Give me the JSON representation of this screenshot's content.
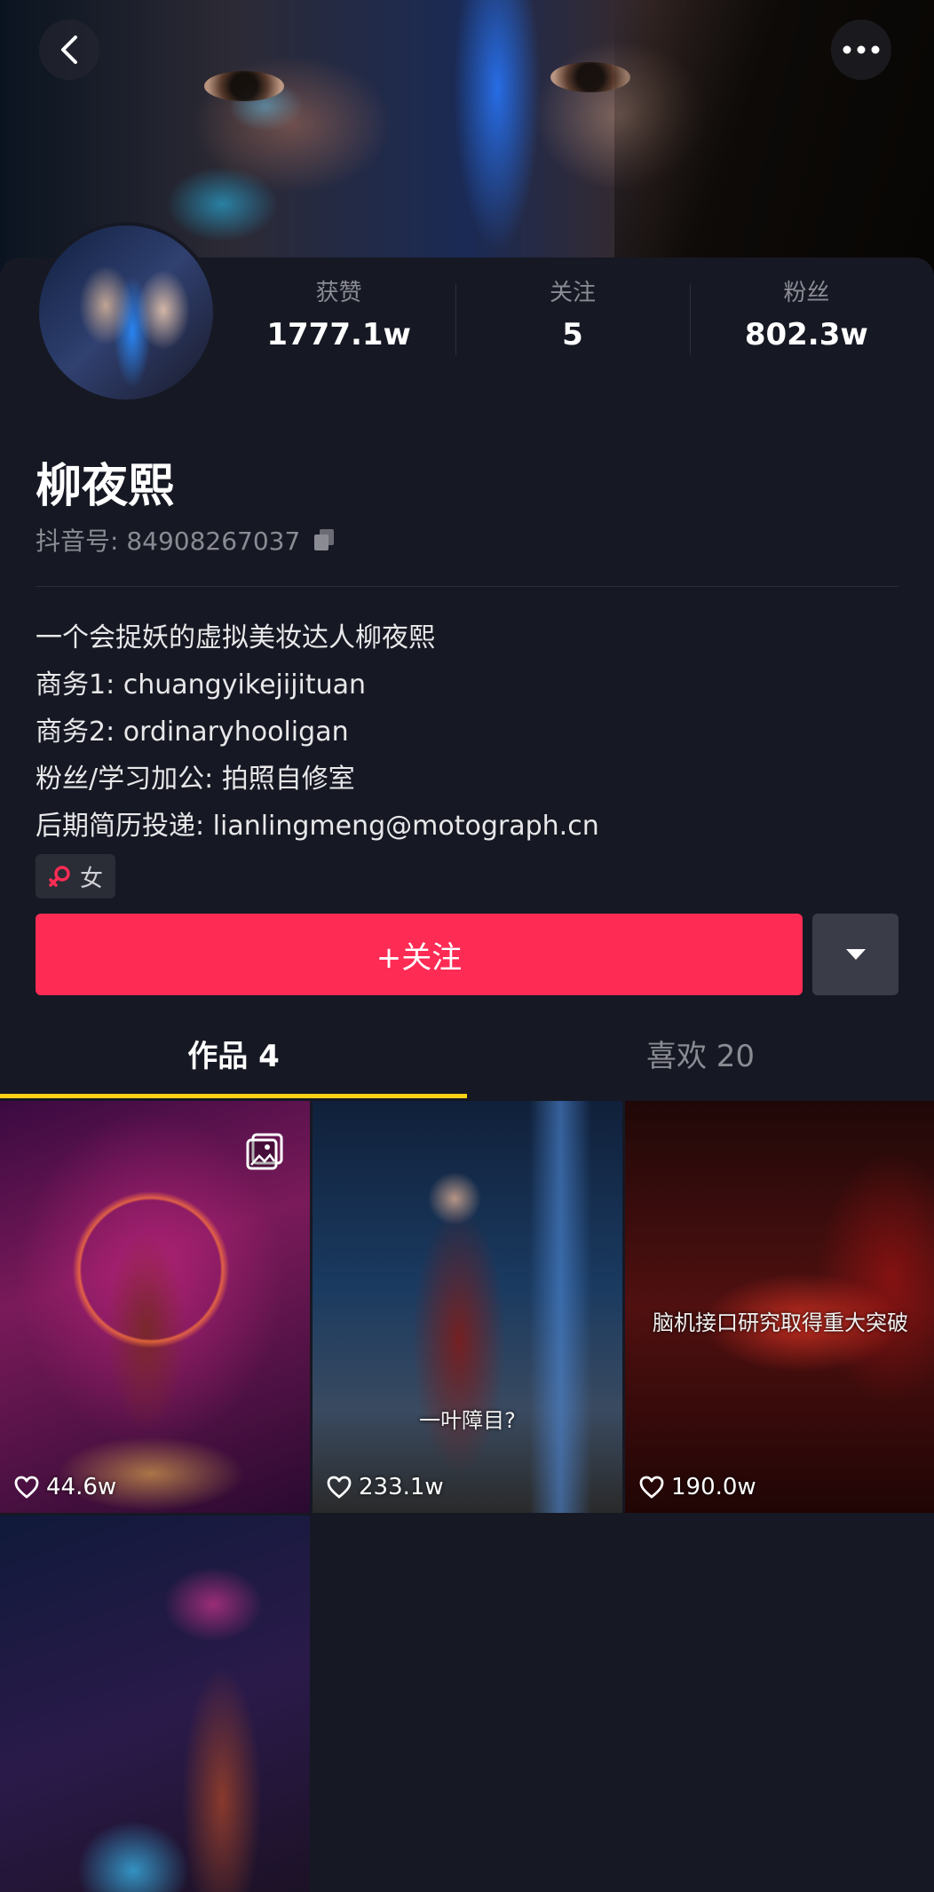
{
  "header": {
    "back_icon": "chevron-left-icon",
    "more_icon": "more-horizontal-icon"
  },
  "profile": {
    "avatar_icon": "avatar",
    "stats": [
      {
        "label": "获赞",
        "value": "1777.1w"
      },
      {
        "label": "关注",
        "value": "5"
      },
      {
        "label": "粉丝",
        "value": "802.3w"
      }
    ],
    "name": "柳夜熙",
    "douyin_id_label": "抖音号: 84908267037",
    "copy_icon": "copy-icon",
    "bio": [
      "一个会捉妖的虚拟美妆达人柳夜熙",
      "商务1: chuangyikejijituan",
      "商务2: ordinaryhooligan",
      "粉丝/学习加公: 拍照自修室",
      "后期简历投递: lianlingmeng@motograph.cn"
    ],
    "gender_label": "女",
    "gender_icon": "female-icon"
  },
  "actions": {
    "follow_label": "+关注",
    "dropdown_icon": "caret-down-icon"
  },
  "tabs": [
    {
      "label": "作品 4",
      "active": true
    },
    {
      "label": "喜欢 20",
      "active": false
    }
  ],
  "colors": {
    "background": "#161823",
    "accent": "#fe2c55",
    "tab_indicator": "#fcd116"
  },
  "videos": [
    {
      "likes": "44.6w",
      "caption": "",
      "gallery": true
    },
    {
      "likes": "233.1w",
      "caption": "一叶障目?",
      "gallery": false
    },
    {
      "likes": "190.0w",
      "caption": "脑机接口研究取得重大突破",
      "gallery": false
    },
    {
      "likes": "",
      "caption": "",
      "gallery": false
    }
  ]
}
